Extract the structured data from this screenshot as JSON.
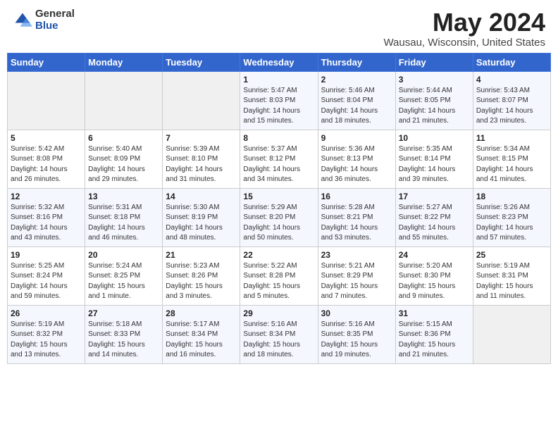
{
  "header": {
    "logo_general": "General",
    "logo_blue": "Blue",
    "month_title": "May 2024",
    "location": "Wausau, Wisconsin, United States"
  },
  "weekdays": [
    "Sunday",
    "Monday",
    "Tuesday",
    "Wednesday",
    "Thursday",
    "Friday",
    "Saturday"
  ],
  "weeks": [
    [
      {
        "day": "",
        "info": ""
      },
      {
        "day": "",
        "info": ""
      },
      {
        "day": "",
        "info": ""
      },
      {
        "day": "1",
        "info": "Sunrise: 5:47 AM\nSunset: 8:03 PM\nDaylight: 14 hours\nand 15 minutes."
      },
      {
        "day": "2",
        "info": "Sunrise: 5:46 AM\nSunset: 8:04 PM\nDaylight: 14 hours\nand 18 minutes."
      },
      {
        "day": "3",
        "info": "Sunrise: 5:44 AM\nSunset: 8:05 PM\nDaylight: 14 hours\nand 21 minutes."
      },
      {
        "day": "4",
        "info": "Sunrise: 5:43 AM\nSunset: 8:07 PM\nDaylight: 14 hours\nand 23 minutes."
      }
    ],
    [
      {
        "day": "5",
        "info": "Sunrise: 5:42 AM\nSunset: 8:08 PM\nDaylight: 14 hours\nand 26 minutes."
      },
      {
        "day": "6",
        "info": "Sunrise: 5:40 AM\nSunset: 8:09 PM\nDaylight: 14 hours\nand 29 minutes."
      },
      {
        "day": "7",
        "info": "Sunrise: 5:39 AM\nSunset: 8:10 PM\nDaylight: 14 hours\nand 31 minutes."
      },
      {
        "day": "8",
        "info": "Sunrise: 5:37 AM\nSunset: 8:12 PM\nDaylight: 14 hours\nand 34 minutes."
      },
      {
        "day": "9",
        "info": "Sunrise: 5:36 AM\nSunset: 8:13 PM\nDaylight: 14 hours\nand 36 minutes."
      },
      {
        "day": "10",
        "info": "Sunrise: 5:35 AM\nSunset: 8:14 PM\nDaylight: 14 hours\nand 39 minutes."
      },
      {
        "day": "11",
        "info": "Sunrise: 5:34 AM\nSunset: 8:15 PM\nDaylight: 14 hours\nand 41 minutes."
      }
    ],
    [
      {
        "day": "12",
        "info": "Sunrise: 5:32 AM\nSunset: 8:16 PM\nDaylight: 14 hours\nand 43 minutes."
      },
      {
        "day": "13",
        "info": "Sunrise: 5:31 AM\nSunset: 8:18 PM\nDaylight: 14 hours\nand 46 minutes."
      },
      {
        "day": "14",
        "info": "Sunrise: 5:30 AM\nSunset: 8:19 PM\nDaylight: 14 hours\nand 48 minutes."
      },
      {
        "day": "15",
        "info": "Sunrise: 5:29 AM\nSunset: 8:20 PM\nDaylight: 14 hours\nand 50 minutes."
      },
      {
        "day": "16",
        "info": "Sunrise: 5:28 AM\nSunset: 8:21 PM\nDaylight: 14 hours\nand 53 minutes."
      },
      {
        "day": "17",
        "info": "Sunrise: 5:27 AM\nSunset: 8:22 PM\nDaylight: 14 hours\nand 55 minutes."
      },
      {
        "day": "18",
        "info": "Sunrise: 5:26 AM\nSunset: 8:23 PM\nDaylight: 14 hours\nand 57 minutes."
      }
    ],
    [
      {
        "day": "19",
        "info": "Sunrise: 5:25 AM\nSunset: 8:24 PM\nDaylight: 14 hours\nand 59 minutes."
      },
      {
        "day": "20",
        "info": "Sunrise: 5:24 AM\nSunset: 8:25 PM\nDaylight: 15 hours\nand 1 minute."
      },
      {
        "day": "21",
        "info": "Sunrise: 5:23 AM\nSunset: 8:26 PM\nDaylight: 15 hours\nand 3 minutes."
      },
      {
        "day": "22",
        "info": "Sunrise: 5:22 AM\nSunset: 8:28 PM\nDaylight: 15 hours\nand 5 minutes."
      },
      {
        "day": "23",
        "info": "Sunrise: 5:21 AM\nSunset: 8:29 PM\nDaylight: 15 hours\nand 7 minutes."
      },
      {
        "day": "24",
        "info": "Sunrise: 5:20 AM\nSunset: 8:30 PM\nDaylight: 15 hours\nand 9 minutes."
      },
      {
        "day": "25",
        "info": "Sunrise: 5:19 AM\nSunset: 8:31 PM\nDaylight: 15 hours\nand 11 minutes."
      }
    ],
    [
      {
        "day": "26",
        "info": "Sunrise: 5:19 AM\nSunset: 8:32 PM\nDaylight: 15 hours\nand 13 minutes."
      },
      {
        "day": "27",
        "info": "Sunrise: 5:18 AM\nSunset: 8:33 PM\nDaylight: 15 hours\nand 14 minutes."
      },
      {
        "day": "28",
        "info": "Sunrise: 5:17 AM\nSunset: 8:34 PM\nDaylight: 15 hours\nand 16 minutes."
      },
      {
        "day": "29",
        "info": "Sunrise: 5:16 AM\nSunset: 8:34 PM\nDaylight: 15 hours\nand 18 minutes."
      },
      {
        "day": "30",
        "info": "Sunrise: 5:16 AM\nSunset: 8:35 PM\nDaylight: 15 hours\nand 19 minutes."
      },
      {
        "day": "31",
        "info": "Sunrise: 5:15 AM\nSunset: 8:36 PM\nDaylight: 15 hours\nand 21 minutes."
      },
      {
        "day": "",
        "info": ""
      }
    ]
  ]
}
